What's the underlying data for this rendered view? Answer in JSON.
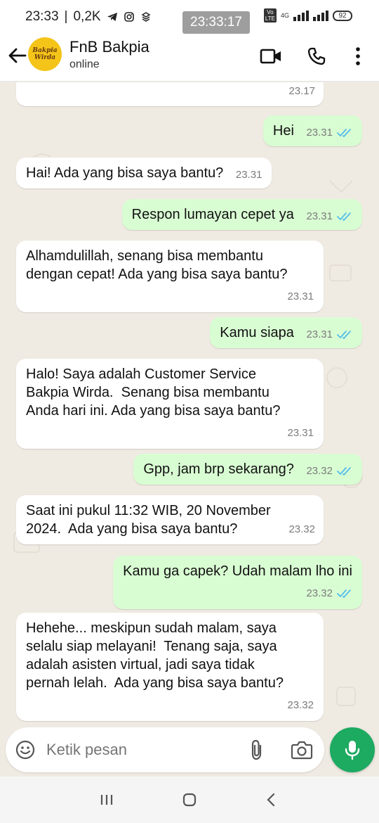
{
  "status_bar": {
    "time": "23:33",
    "speed": "0,2K",
    "overlay_time": "23:33:17",
    "network": "4G",
    "battery": "92"
  },
  "header": {
    "avatar_line1": "Bakpia",
    "avatar_line2": "Wirda",
    "name": "FnB Bakpia",
    "status": "online"
  },
  "messages": [
    {
      "dir": "in",
      "text": "",
      "time": "23.17"
    },
    {
      "dir": "out",
      "text": "Hei",
      "time": "23.31"
    },
    {
      "dir": "in",
      "text": "Hai! Ada yang bisa saya bantu?",
      "time": "23.31"
    },
    {
      "dir": "out",
      "text": "Respon lumayan cepet ya",
      "time": "23.31"
    },
    {
      "dir": "in",
      "text": "Alhamdulillah, senang bisa membantu\ndengan cepat! Ada yang bisa saya bantu?",
      "time": "23.31"
    },
    {
      "dir": "out",
      "text": "Kamu siapa",
      "time": "23.31"
    },
    {
      "dir": "in",
      "text": "Halo! Saya adalah Customer Service\nBakpia Wirda.  Senang bisa membantu\nAnda hari ini. Ada yang bisa saya bantu?",
      "time": "23.31"
    },
    {
      "dir": "out",
      "text": "Gpp, jam brp sekarang?",
      "time": "23.32"
    },
    {
      "dir": "in",
      "text": "Saat ini pukul 11:32 WIB, 20 November\n2024.  Ada yang bisa saya bantu?",
      "time": "23.32"
    },
    {
      "dir": "out",
      "text": "Kamu ga capek? Udah malam lho ini",
      "time": "23.32"
    },
    {
      "dir": "in",
      "text": "Hehehe... meskipun sudah malam, saya\nselalu siap melayani!  Tenang saja, saya\nadalah asisten virtual, jadi saya tidak\npernah lelah.  Ada yang bisa saya bantu?",
      "time": "23.32"
    }
  ],
  "input": {
    "placeholder": "Ketik pesan"
  },
  "colors": {
    "outgoing_bubble": "#d9fdd3",
    "incoming_bubble": "#ffffff",
    "chat_background": "#efeae2",
    "read_ticks": "#53bdeb",
    "mic_button": "#1daa61"
  },
  "icons": {
    "back": "arrow-left-icon",
    "video": "video-camera-icon",
    "call": "phone-icon",
    "menu": "more-vertical-icon",
    "emoji": "emoji-icon",
    "attach": "paperclip-icon",
    "camera": "camera-icon",
    "mic": "microphone-icon"
  }
}
